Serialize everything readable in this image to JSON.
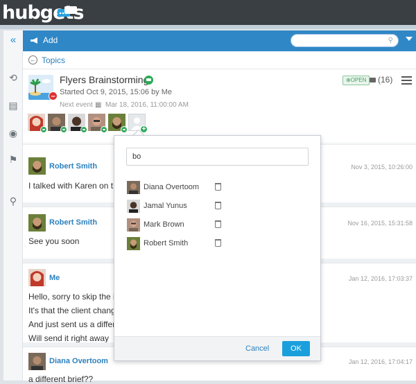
{
  "app": {
    "logo": "hubgets"
  },
  "toolbar": {
    "add_label": "Add",
    "search_placeholder": ""
  },
  "nav": {
    "topics_label": "Topics"
  },
  "topic": {
    "title": "Flyers Brainstorming",
    "started": "Started Oct 9, 2015, 15:06 by Me",
    "next_event_label": "Next event",
    "next_event_date": "Mar 18, 2016, 11:00:00 AM",
    "status": "OPEN",
    "comment_count": "(16)"
  },
  "participants": [
    {
      "name": "participant-1",
      "color": "#c0392b"
    },
    {
      "name": "participant-2",
      "color": "#5a4636"
    },
    {
      "name": "participant-3",
      "color": "#3e2f25"
    },
    {
      "name": "participant-4",
      "color": "#9c6b52"
    },
    {
      "name": "participant-5",
      "color": "#4c5a2a"
    }
  ],
  "popup": {
    "search_value": "bo",
    "results": [
      {
        "name": "Diana Overtoom"
      },
      {
        "name": "Jamal Yunus"
      },
      {
        "name": "Mark Brown"
      },
      {
        "name": "Robert Smith"
      }
    ],
    "cancel_label": "Cancel",
    "ok_label": "OK"
  },
  "messages": [
    {
      "author": "Robert Smith",
      "time": "Nov 3, 2015, 10:26:00",
      "lines": [
        "I talked with Karen on th"
      ]
    },
    {
      "author": "Robert Smith",
      "time": "Nov 16, 2015, 15:31:58",
      "lines": [
        "See you soon"
      ]
    },
    {
      "author": "Me",
      "time": "Jan 12, 2016, 17:03:37",
      "lines": [
        "Hello, sorry to skip the i",
        "It's that the client chang",
        "And just sent us a differ",
        "Will send it right away"
      ]
    },
    {
      "author": "Diana Overtoom",
      "time": "Jan 12, 2016, 17:04:17",
      "lines": [
        "a different brief??"
      ]
    }
  ],
  "colors": {
    "accent": "#2f87c6",
    "topbar": "#3a3f44",
    "ok_button": "#1a9fdc",
    "status_green": "#2eaa5a"
  }
}
